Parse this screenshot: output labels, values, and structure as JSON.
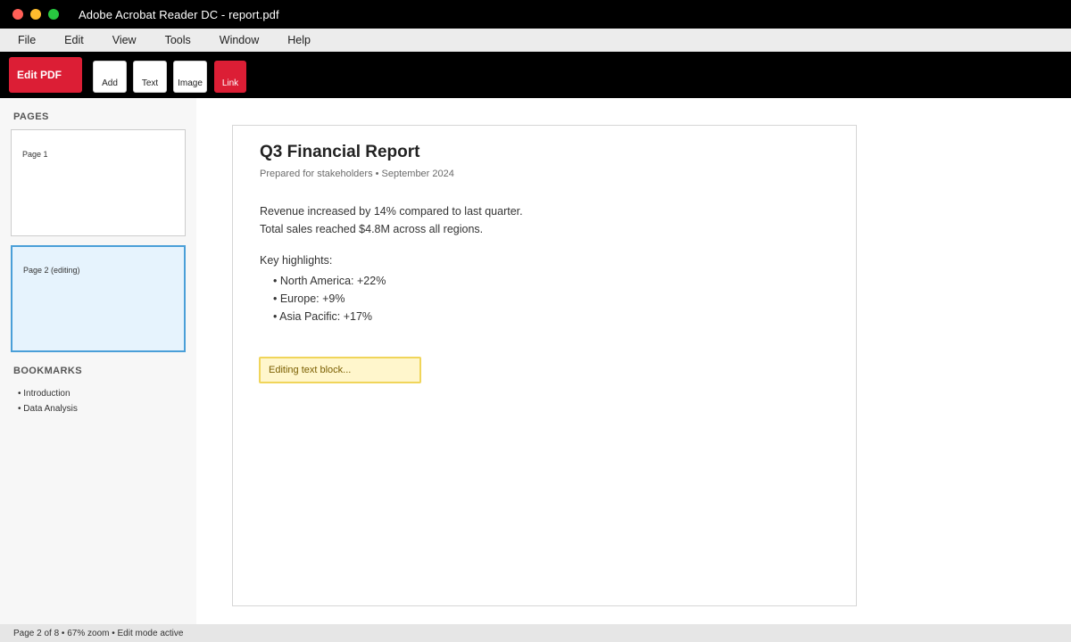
{
  "window": {
    "title": "Adobe Acrobat Reader DC - report.pdf"
  },
  "menu": {
    "items": [
      "File",
      "Edit",
      "View",
      "Tools",
      "Window",
      "Help"
    ]
  },
  "toolbar": {
    "edit_pdf": "Edit PDF",
    "tools": [
      "Add",
      "Text",
      "Image",
      "Link"
    ],
    "active_tool": "Link"
  },
  "sidebar": {
    "pages_title": "PAGES",
    "pages": [
      {
        "label": "Page 1",
        "selected": false
      },
      {
        "label": "Page 2 (editing)",
        "selected": true
      }
    ],
    "bookmarks_title": "BOOKMARKS",
    "bookmarks": [
      "• Introduction",
      "• Data Analysis"
    ]
  },
  "document": {
    "title": "Q3 Financial Report",
    "subtitle": "Prepared for stakeholders • September 2024",
    "paragraph_lines": [
      "Revenue increased by 14% compared to last quarter.",
      "Total sales reached $4.8M across all regions."
    ],
    "highlights_label": "Key highlights:",
    "highlights": [
      "• North America: +22%",
      "• Europe: +9%",
      "• Asia Pacific: +17%"
    ],
    "editing_block": "Editing text block..."
  },
  "status": {
    "text": "Page 2 of 8 • 67% zoom • Edit mode active"
  },
  "colors": {
    "accent": "#dc1e35",
    "selection": "#4a9fd8",
    "edit_highlight": "#fff6cc"
  }
}
